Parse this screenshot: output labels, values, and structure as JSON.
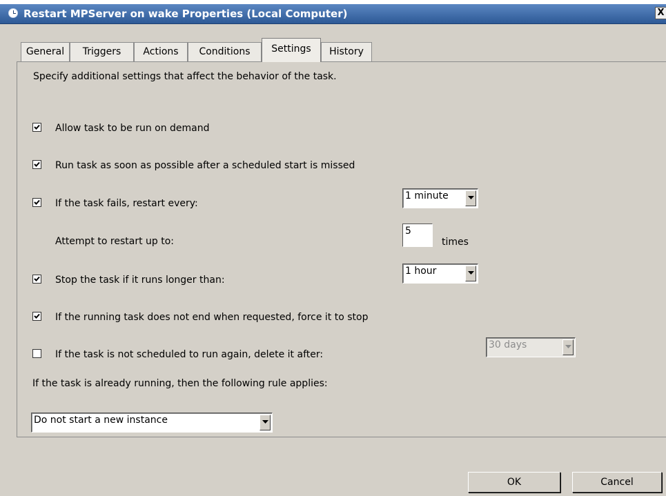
{
  "window": {
    "title": "Restart MPServer on wake Properties (Local Computer)",
    "close_glyph": "X"
  },
  "tabs": [
    {
      "label": "General"
    },
    {
      "label": "Triggers"
    },
    {
      "label": "Actions"
    },
    {
      "label": "Conditions"
    },
    {
      "label": "Settings",
      "active": true
    },
    {
      "label": "History"
    }
  ],
  "settings": {
    "description": "Specify additional settings that affect the behavior of the task.",
    "allow_on_demand": {
      "label": "Allow task to be run on demand",
      "checked": true
    },
    "run_asap": {
      "label": "Run task as soon as possible after a scheduled start is missed",
      "checked": true
    },
    "restart_on_fail": {
      "label": "If the task fails, restart every:",
      "checked": true,
      "interval": "1 minute"
    },
    "restart_attempts": {
      "label": "Attempt to restart up to:",
      "value": "5",
      "unit": "times"
    },
    "stop_if_long": {
      "label": "Stop the task if it runs longer than:",
      "checked": true,
      "duration": "1 hour"
    },
    "force_stop": {
      "label": "If the running task does not end when requested, force it to stop",
      "checked": true
    },
    "delete_after": {
      "label": "If the task is not scheduled to run again, delete it after:",
      "checked": false,
      "duration": "30 days"
    },
    "running_rule": {
      "label": "If the task is already running, then the following rule applies:",
      "value": "Do not start a new instance"
    }
  },
  "buttons": {
    "ok": "OK",
    "cancel": "Cancel"
  }
}
